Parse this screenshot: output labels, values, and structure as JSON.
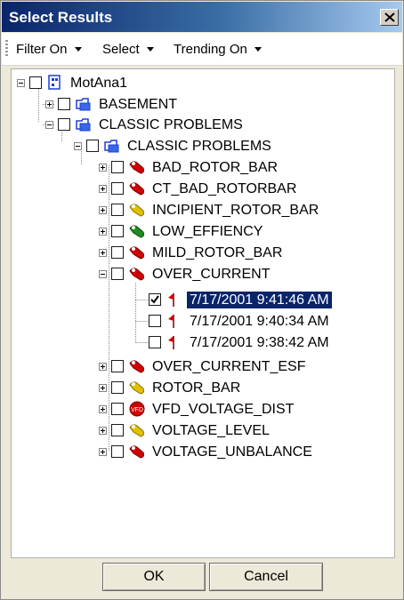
{
  "window": {
    "title": "Select Results"
  },
  "toolbar": {
    "filter_label": "Filter On",
    "select_label": "Select",
    "trending_label": "Trending On"
  },
  "tree": {
    "root": "MotAna1",
    "basement": "BASEMENT",
    "classic_group": "CLASSIC PROBLEMS",
    "classic_sub": "CLASSIC PROBLEMS",
    "items": [
      {
        "label": "BAD_ROTOR_BAR",
        "icon": "red-fault-icon"
      },
      {
        "label": "CT_BAD_ROTORBAR",
        "icon": "red-fault-icon"
      },
      {
        "label": "INCIPIENT_ROTOR_BAR",
        "icon": "yellow-fault-icon"
      },
      {
        "label": "LOW_EFFIENCY",
        "icon": "green-fault-icon"
      },
      {
        "label": "MILD_ROTOR_BAR",
        "icon": "red-fault-icon"
      },
      {
        "label": "OVER_CURRENT",
        "icon": "red-fault-icon"
      },
      {
        "label": "OVER_CURRENT_ESF",
        "icon": "red-fault-icon"
      },
      {
        "label": "ROTOR_BAR",
        "icon": "yellow-fault-icon"
      },
      {
        "label": "VFD_VOLTAGE_DIST",
        "icon": "red-circle-fault-icon"
      },
      {
        "label": "VOLTAGE_LEVEL",
        "icon": "yellow-fault-icon"
      },
      {
        "label": "VOLTAGE_UNBALANCE",
        "icon": "red-fault-icon"
      }
    ],
    "results": [
      {
        "label": "7/17/2001 9:41:46 AM",
        "checked": true,
        "selected": true
      },
      {
        "label": "7/17/2001 9:40:34 AM",
        "checked": false,
        "selected": false
      },
      {
        "label": "7/17/2001 9:38:42 AM",
        "checked": false,
        "selected": false
      }
    ]
  },
  "buttons": {
    "ok": "OK",
    "cancel": "Cancel"
  },
  "colors": {
    "title_start": "#0a246a",
    "title_end": "#a6caf0",
    "selection": "#0a246a",
    "fault_red": "#d10000",
    "fault_yellow": "#e0c000",
    "fault_green": "#1f8a1f",
    "folder_blue": "#1c3fd6"
  }
}
